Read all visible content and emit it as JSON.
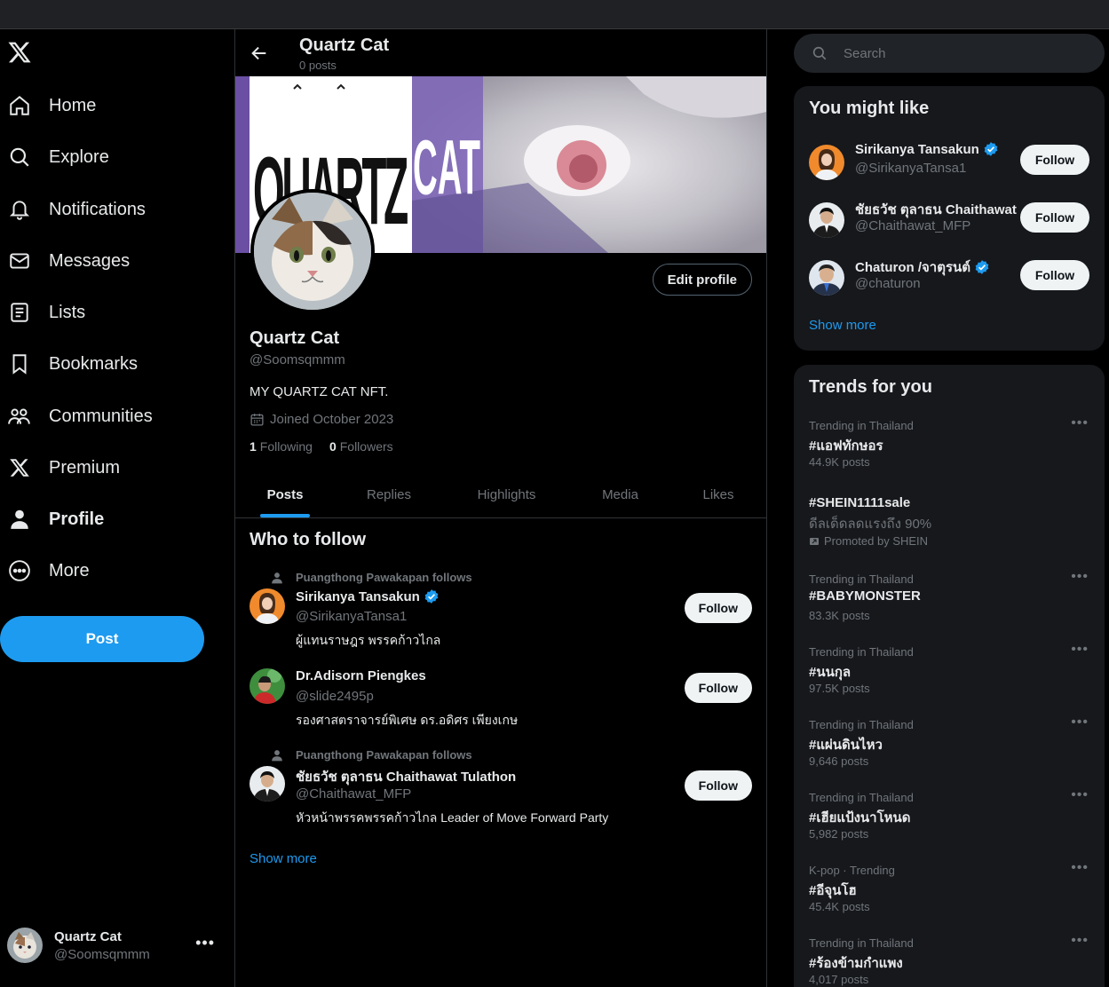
{
  "nav": {
    "items": [
      {
        "label": "Home",
        "icon": "home-icon"
      },
      {
        "label": "Explore",
        "icon": "search-icon"
      },
      {
        "label": "Notifications",
        "icon": "bell-icon"
      },
      {
        "label": "Messages",
        "icon": "mail-icon"
      },
      {
        "label": "Lists",
        "icon": "list-icon"
      },
      {
        "label": "Bookmarks",
        "icon": "bookmark-icon"
      },
      {
        "label": "Communities",
        "icon": "communities-icon"
      },
      {
        "label": "Premium",
        "icon": "x-logo-icon"
      },
      {
        "label": "Profile",
        "icon": "person-icon"
      },
      {
        "label": "More",
        "icon": "more-circle-icon"
      }
    ],
    "post_label": "Post"
  },
  "account": {
    "name": "Quartz Cat",
    "handle": "@Soomsqmmm"
  },
  "header": {
    "title": "Quartz Cat",
    "subtitle": "0 posts"
  },
  "banner": {
    "brand_text_left": "QUARTZ",
    "brand_text_right": "CAT"
  },
  "profile": {
    "edit_label": "Edit profile",
    "name": "Quartz Cat",
    "handle": "@Soomsqmmm",
    "bio": "MY QUARTZ CAT NFT.",
    "joined": "Joined October 2023",
    "following_count": "1",
    "following_label": "Following",
    "followers_count": "0",
    "followers_label": "Followers"
  },
  "tabs": [
    "Posts",
    "Replies",
    "Highlights",
    "Media",
    "Likes"
  ],
  "who_to_follow": {
    "title": "Who to follow",
    "items": [
      {
        "context": "Puangthong Pawakapan follows",
        "name": "Sirikanya Tansakun",
        "handle": "@SirikanyaTansa1",
        "bio": "ผู้แทนราษฎร พรรคก้าวไกล",
        "verified": true,
        "follow": "Follow"
      },
      {
        "context": "",
        "name": "Dr.Adisorn Piengkes",
        "handle": "@slide2495p",
        "bio": "รองศาสตราจารย์พิเศษ ดร.อดิศร เพียงเกษ",
        "verified": false,
        "follow": "Follow"
      },
      {
        "context": "Puangthong Pawakapan follows",
        "name": "ชัยธวัช ตุลาธน Chaithawat Tulathon",
        "handle": "@Chaithawat_MFP",
        "bio": "หัวหน้าพรรคพรรคก้าวไกล Leader of Move Forward Party",
        "verified": false,
        "follow": "Follow"
      }
    ],
    "show_more": "Show more"
  },
  "search": {
    "placeholder": "Search"
  },
  "you_might_like": {
    "title": "You might like",
    "items": [
      {
        "name": "Sirikanya Tansakun",
        "handle": "@SirikanyaTansa1",
        "verified": true,
        "follow": "Follow"
      },
      {
        "name": "ชัยธวัช ตุลาธน Chaithawat",
        "handle": "@Chaithawat_MFP",
        "verified": false,
        "follow": "Follow"
      },
      {
        "name": "Chaturon /จาตุรนต์",
        "handle": "@chaturon",
        "verified": true,
        "follow": "Follow"
      }
    ],
    "show_more": "Show more"
  },
  "trends": {
    "title": "Trends for you",
    "items": [
      {
        "context": "Trending in Thailand",
        "name": "#แอฟทักษอร",
        "count": "44.9K posts"
      },
      {
        "context": "",
        "name": "#SHEIN1111sale",
        "desc": "ดีลเด็ดลดแรงถึง 90%",
        "promoted": "Promoted by SHEIN"
      },
      {
        "context": "Trending in Thailand",
        "name": "#BABYMONSTER",
        "count": "83.3K posts"
      },
      {
        "context": "Trending in Thailand",
        "name": "#นนกุล",
        "count": "97.5K posts"
      },
      {
        "context": "Trending in Thailand",
        "name": "#แผ่นดินไหว",
        "count": "9,646 posts"
      },
      {
        "context": "Trending in Thailand",
        "name": "#เฮียแป้งนาโหนด",
        "count": "5,982 posts"
      },
      {
        "context": "K-pop · Trending",
        "name": "#อีจุนโฮ",
        "count": "45.4K posts"
      },
      {
        "context": "Trending in Thailand",
        "name": "#ร้องข้ามกำแพง",
        "count": "4,017 posts"
      }
    ]
  },
  "colors": {
    "accent": "#1d9bf0",
    "background": "#000000",
    "card": "#16181c",
    "muted": "#71767b"
  }
}
